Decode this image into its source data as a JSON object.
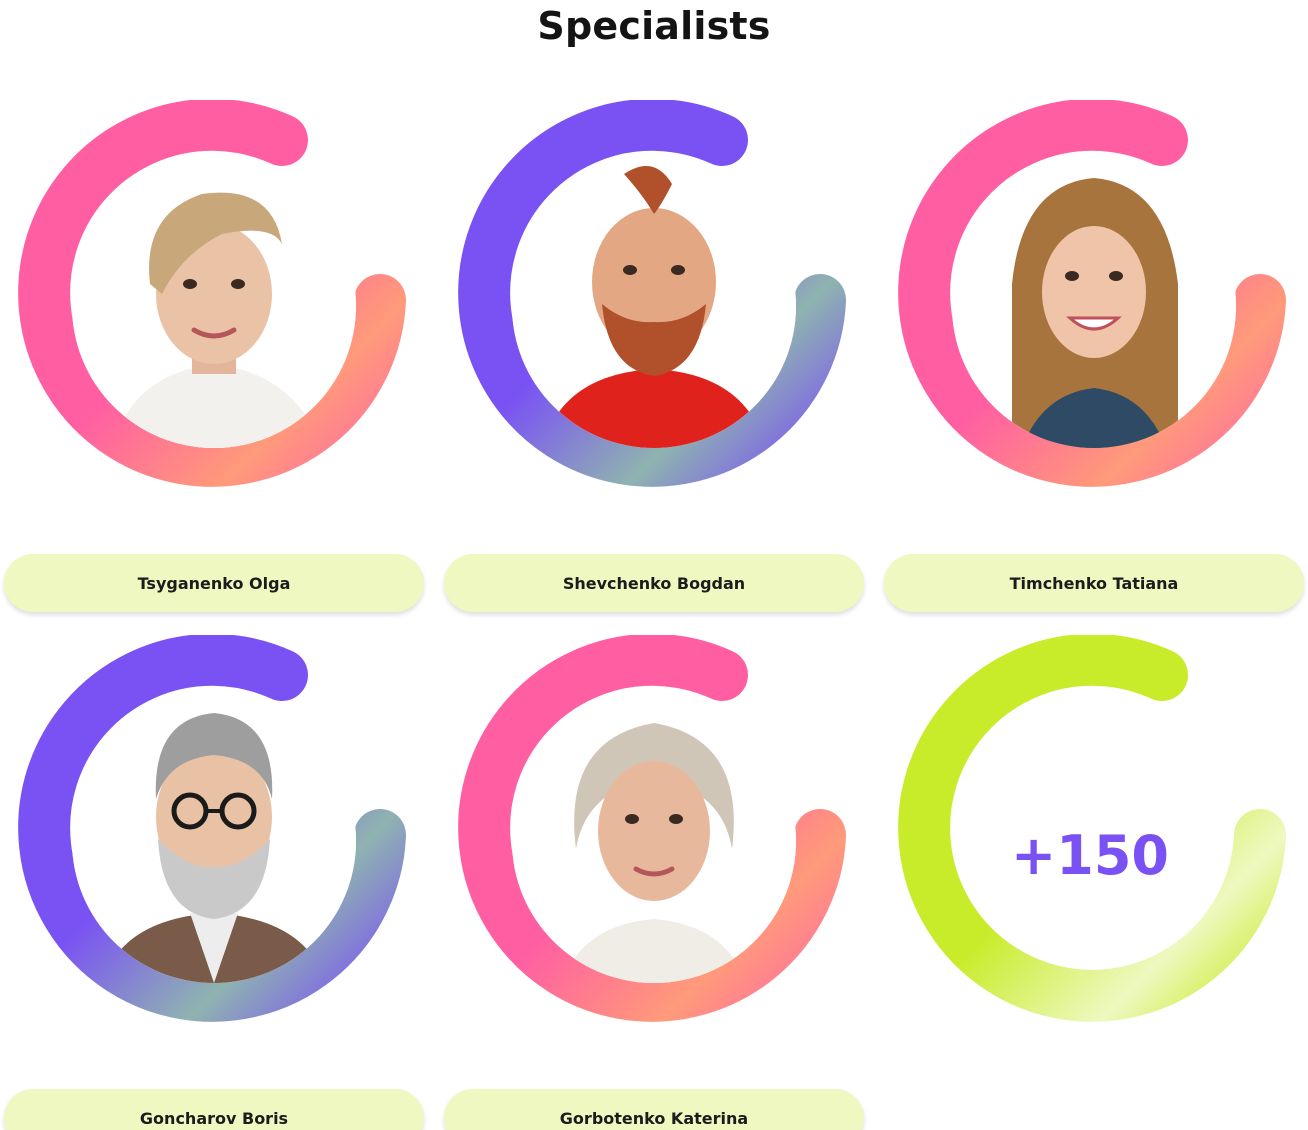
{
  "page": {
    "title": "Specialists"
  },
  "colors": {
    "pink_ring_start": "#ff5fa2",
    "pink_ring_end": "#ff9a7a",
    "purple_ring_start": "#7a52f4",
    "purple_ring_end": "#8fb3b0",
    "green_ring_start": "#c8ec2a",
    "green_ring_end": "#eef8c0",
    "pill_bg": "#eef8c0",
    "count_text": "#7a52f4"
  },
  "specialists": [
    {
      "name": "Tsyganenko Olga",
      "ring": "pink",
      "portrait": "woman-short-blonde-hair"
    },
    {
      "name": "Shevchenko Bogdan",
      "ring": "purple",
      "portrait": "man-red-beard-red-hoodie"
    },
    {
      "name": "Timchenko Tatiana",
      "ring": "pink",
      "portrait": "woman-long-brown-hair"
    },
    {
      "name": "Goncharov Boris",
      "ring": "purple",
      "portrait": "man-grey-beard-glasses"
    },
    {
      "name": "Gorbotenko Katerina",
      "ring": "pink",
      "portrait": "woman-grey-curly-hair"
    }
  ],
  "more": {
    "count_label": "+150",
    "ring": "green"
  }
}
